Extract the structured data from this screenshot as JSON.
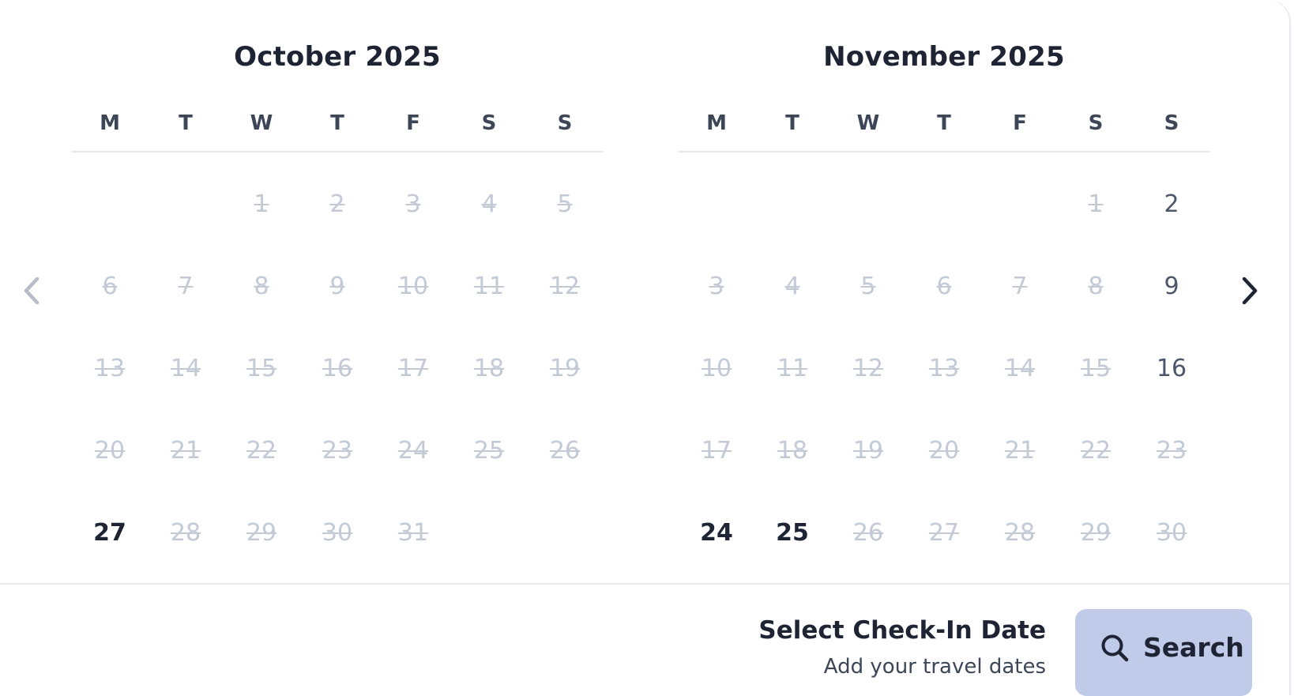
{
  "calendar": {
    "months": [
      {
        "title": "October 2025",
        "weekdays": [
          "M",
          "T",
          "W",
          "T",
          "F",
          "S",
          "S"
        ],
        "weeks": [
          [
            null,
            null,
            {
              "d": "1",
              "s": "disabled"
            },
            {
              "d": "2",
              "s": "disabled"
            },
            {
              "d": "3",
              "s": "disabled"
            },
            {
              "d": "4",
              "s": "disabled"
            },
            {
              "d": "5",
              "s": "disabled"
            }
          ],
          [
            {
              "d": "6",
              "s": "disabled"
            },
            {
              "d": "7",
              "s": "disabled"
            },
            {
              "d": "8",
              "s": "disabled"
            },
            {
              "d": "9",
              "s": "disabled"
            },
            {
              "d": "10",
              "s": "disabled"
            },
            {
              "d": "11",
              "s": "disabled"
            },
            {
              "d": "12",
              "s": "disabled"
            }
          ],
          [
            {
              "d": "13",
              "s": "disabled"
            },
            {
              "d": "14",
              "s": "disabled"
            },
            {
              "d": "15",
              "s": "disabled"
            },
            {
              "d": "16",
              "s": "disabled"
            },
            {
              "d": "17",
              "s": "disabled"
            },
            {
              "d": "18",
              "s": "disabled"
            },
            {
              "d": "19",
              "s": "disabled"
            }
          ],
          [
            {
              "d": "20",
              "s": "disabled"
            },
            {
              "d": "21",
              "s": "disabled"
            },
            {
              "d": "22",
              "s": "disabled"
            },
            {
              "d": "23",
              "s": "disabled"
            },
            {
              "d": "24",
              "s": "disabled"
            },
            {
              "d": "25",
              "s": "disabled"
            },
            {
              "d": "26",
              "s": "disabled"
            }
          ],
          [
            {
              "d": "27",
              "s": "strong"
            },
            {
              "d": "28",
              "s": "disabled"
            },
            {
              "d": "29",
              "s": "disabled"
            },
            {
              "d": "30",
              "s": "disabled"
            },
            {
              "d": "31",
              "s": "disabled"
            },
            null,
            null
          ]
        ]
      },
      {
        "title": "November 2025",
        "weekdays": [
          "M",
          "T",
          "W",
          "T",
          "F",
          "S",
          "S"
        ],
        "weeks": [
          [
            null,
            null,
            null,
            null,
            null,
            {
              "d": "1",
              "s": "disabled"
            },
            {
              "d": "2",
              "s": "available"
            }
          ],
          [
            {
              "d": "3",
              "s": "disabled"
            },
            {
              "d": "4",
              "s": "disabled"
            },
            {
              "d": "5",
              "s": "disabled"
            },
            {
              "d": "6",
              "s": "disabled"
            },
            {
              "d": "7",
              "s": "disabled"
            },
            {
              "d": "8",
              "s": "disabled"
            },
            {
              "d": "9",
              "s": "available"
            }
          ],
          [
            {
              "d": "10",
              "s": "disabled"
            },
            {
              "d": "11",
              "s": "disabled"
            },
            {
              "d": "12",
              "s": "disabled"
            },
            {
              "d": "13",
              "s": "disabled"
            },
            {
              "d": "14",
              "s": "disabled"
            },
            {
              "d": "15",
              "s": "disabled"
            },
            {
              "d": "16",
              "s": "available"
            }
          ],
          [
            {
              "d": "17",
              "s": "disabled"
            },
            {
              "d": "18",
              "s": "disabled"
            },
            {
              "d": "19",
              "s": "disabled"
            },
            {
              "d": "20",
              "s": "disabled"
            },
            {
              "d": "21",
              "s": "disabled"
            },
            {
              "d": "22",
              "s": "disabled"
            },
            {
              "d": "23",
              "s": "disabled"
            }
          ],
          [
            {
              "d": "24",
              "s": "strong"
            },
            {
              "d": "25",
              "s": "strong"
            },
            {
              "d": "26",
              "s": "disabled"
            },
            {
              "d": "27",
              "s": "disabled"
            },
            {
              "d": "28",
              "s": "disabled"
            },
            {
              "d": "29",
              "s": "disabled"
            },
            {
              "d": "30",
              "s": "disabled"
            }
          ]
        ]
      }
    ],
    "nav": {
      "prev_icon": "chevron-left-icon",
      "next_icon": "chevron-right-icon"
    }
  },
  "footer": {
    "prompt_title": "Select Check-In Date",
    "prompt_subtitle": "Add your travel dates",
    "search_label": "Search",
    "search_icon": "search-icon"
  },
  "colors": {
    "title_text": "#1e2433",
    "disabled_day": "#c3cad6",
    "available_day": "#4e576a",
    "search_button_bg": "#c0cbea",
    "divider": "#e5e7ec"
  }
}
